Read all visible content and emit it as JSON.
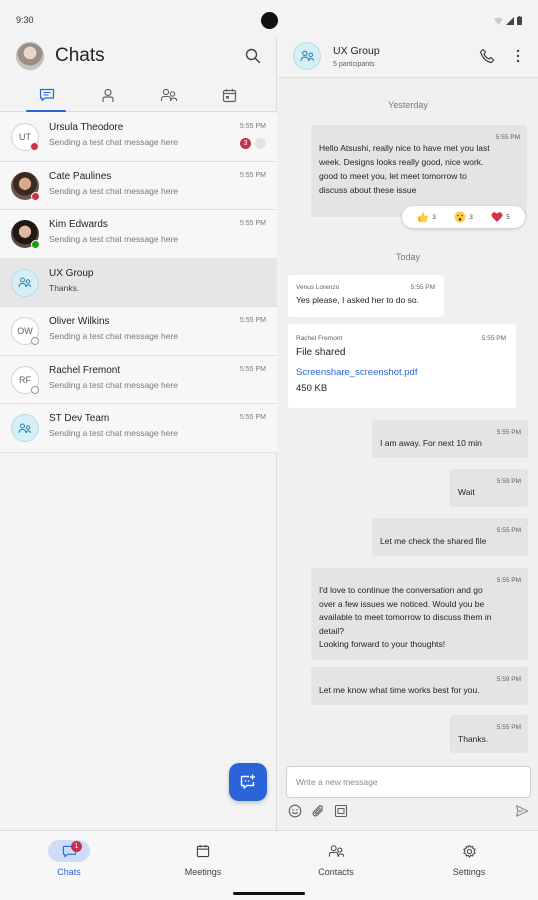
{
  "status_bar": {
    "time": "9:30"
  },
  "left_pane": {
    "title": "Chats",
    "tabs": [
      {
        "icon": "chat-icon",
        "active": true
      },
      {
        "icon": "person-icon",
        "active": false
      },
      {
        "icon": "people-icon",
        "active": false
      },
      {
        "icon": "calendar-icon",
        "active": false
      }
    ],
    "chats": [
      {
        "initials": "UT",
        "name": "Ursula Theodore",
        "preview": "Sending a test chat message here",
        "time": "5:55 PM",
        "unread": "3",
        "presence": "red"
      },
      {
        "initials": "",
        "name": "Cate Paulines",
        "preview": "Sending a test chat message here",
        "time": "5:55 PM",
        "presence": "red"
      },
      {
        "initials": "",
        "name": "Kim Edwards",
        "preview": "Sending a test chat message here",
        "time": "5:55 PM",
        "presence": "green"
      },
      {
        "initials": "",
        "name": "UX Group",
        "preview": "Thanks.",
        "time": "",
        "selected": true
      },
      {
        "initials": "OW",
        "name": "Oliver Wilkins",
        "preview": "Sending a test chat message here",
        "time": "5:55 PM",
        "presence": "grey"
      },
      {
        "initials": "RF",
        "name": "Rachel Fremont",
        "preview": "Sending a test chat message here",
        "time": "5:55 PM",
        "presence": "grey"
      },
      {
        "initials": "",
        "name": "ST Dev Team",
        "preview": "Sending a test chat message here",
        "time": "5:55 PM"
      }
    ]
  },
  "conversation": {
    "title": "UX Group",
    "subtitle": "5 participants",
    "day_yesterday": "Yesterday",
    "day_today": "Today",
    "messages": [
      {
        "time": "5:55 PM",
        "lines": [
          "Hello Atsushi, really nice to have met you last",
          "week. Designs looks really good, nice work.",
          "good to meet you, let meet tomorrow to",
          "discuss about these issue"
        ]
      },
      {
        "sender": "Venus Lorenzo",
        "time": "5:55 PM",
        "lines": [
          "Yes please, I asked her to do so."
        ]
      },
      {
        "sender": "Rachel Fremont",
        "time": "5:55 PM",
        "title": "File shared",
        "file_name": "Screenshare_screenshot.pdf",
        "file_size": "450 KB"
      },
      {
        "time": "5:55 PM",
        "lines": [
          "I am away. For next 10 min"
        ]
      },
      {
        "time": "5:59 PM",
        "lines": [
          "Wait"
        ]
      },
      {
        "time": "5:55 PM",
        "lines": [
          "Let me check the shared file"
        ]
      },
      {
        "time": "5:55 PM",
        "lines": [
          "I'd love to continue the conversation and go",
          "over a few issues we noticed. Would you be",
          "available to meet tomorrow to discuss them in",
          "detail?",
          "Looking forward to your thoughts!"
        ]
      },
      {
        "time": "5:59 PM",
        "lines": [
          "Let me know what time works best for you."
        ]
      },
      {
        "time": "5:55 PM",
        "lines": [
          "Thanks."
        ]
      }
    ],
    "reactions": [
      {
        "emoji": "thumbs-up",
        "count": "3"
      },
      {
        "emoji": "surprised",
        "count": "3"
      },
      {
        "emoji": "heart",
        "count": "5"
      }
    ],
    "compose_placeholder": "Write a new message"
  },
  "bottom_nav": [
    {
      "label": "Chats",
      "badge": "1",
      "active": true
    },
    {
      "label": "Meetings"
    },
    {
      "label": "Contacts"
    },
    {
      "label": "Settings"
    }
  ],
  "colors": {
    "accent": "#2b63d9",
    "badge": "#c4314b",
    "presence_green": "#13a10e",
    "presence_red": "#d13438"
  }
}
